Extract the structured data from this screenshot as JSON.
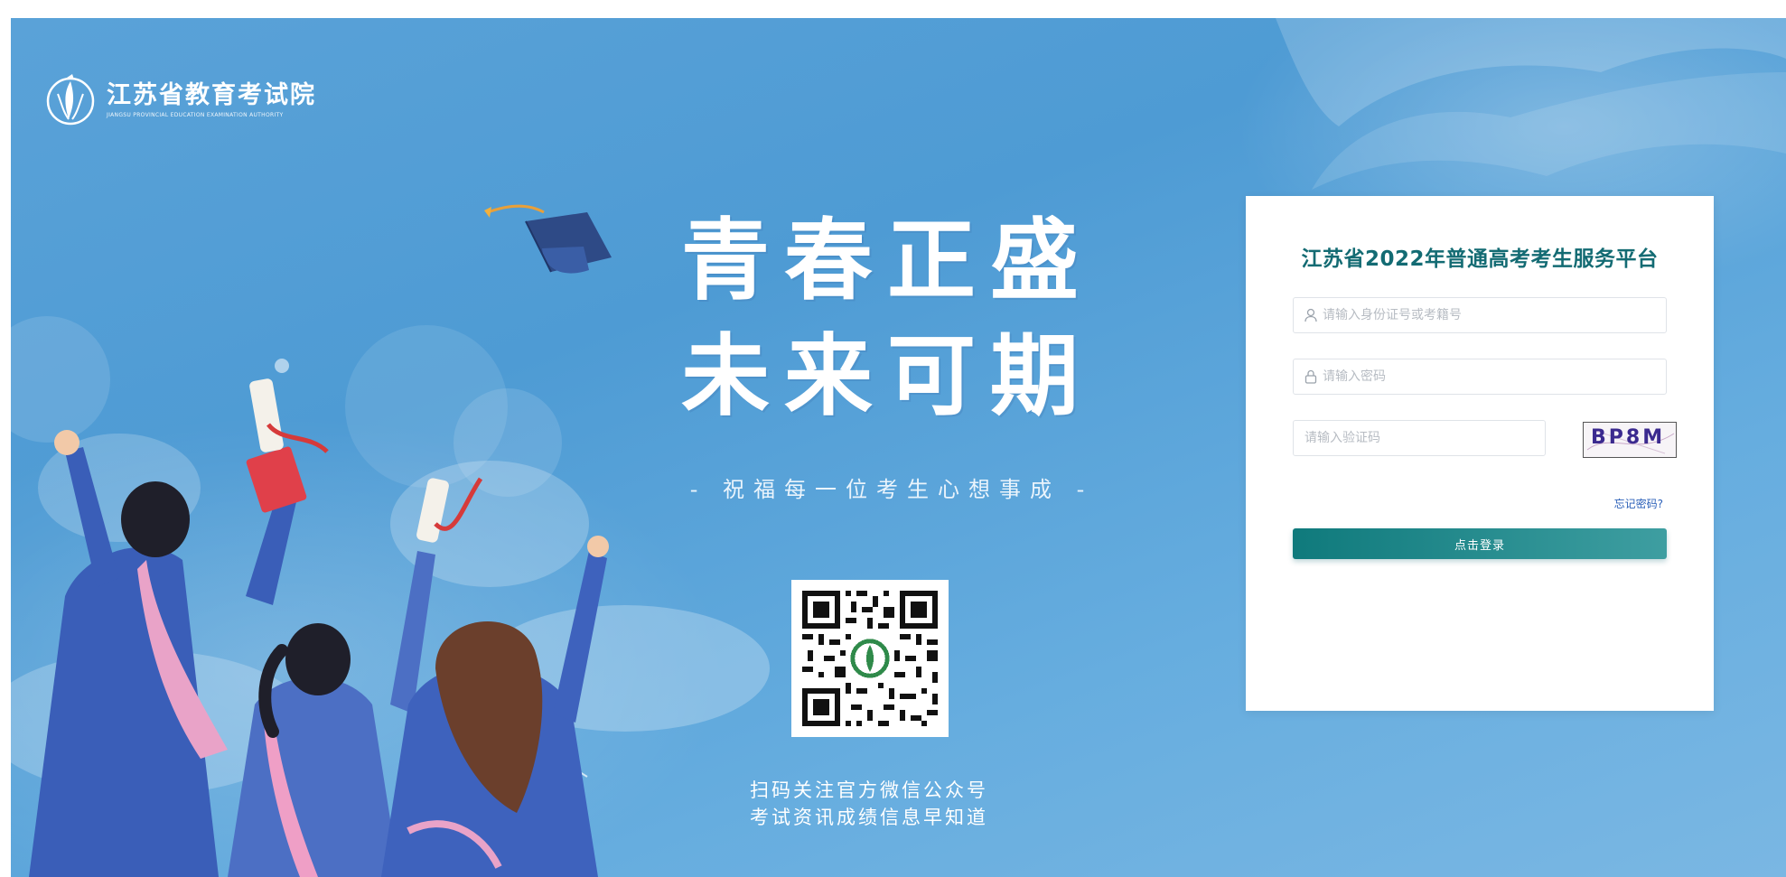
{
  "brand": {
    "name_cn": "江苏省教育考试院",
    "name_en": "JIANGSU PROVINCIAL EDUCATION EXAMINATION AUTHORITY"
  },
  "hero": {
    "slogan_line1": "青春正盛",
    "slogan_line2": "未来可期",
    "wish": "- 祝福每一位考生心想事成 -"
  },
  "qr_caption": {
    "line1": "扫码关注官方微信公众号",
    "line2": "考试资讯成绩信息早知道"
  },
  "login": {
    "title": "江苏省2022年普通高考考生服务平台",
    "id_placeholder": "请输入身份证号或考籍号",
    "password_placeholder": "请输入密码",
    "captcha_placeholder": "请输入验证码",
    "captcha_text": "BP8M",
    "forgot_label": "忘记密码?",
    "submit_label": "点击登录"
  },
  "icons": {
    "logo": "education-authority-emblem-icon",
    "id_field": "user-icon",
    "password_field": "lock-icon",
    "cap": "graduation-cap-icon"
  },
  "colors": {
    "background": "#5aa2d8",
    "title": "#136b73",
    "button_start": "#0f7a7c",
    "button_end": "#3e9ea1",
    "link": "#2a5fb8"
  }
}
